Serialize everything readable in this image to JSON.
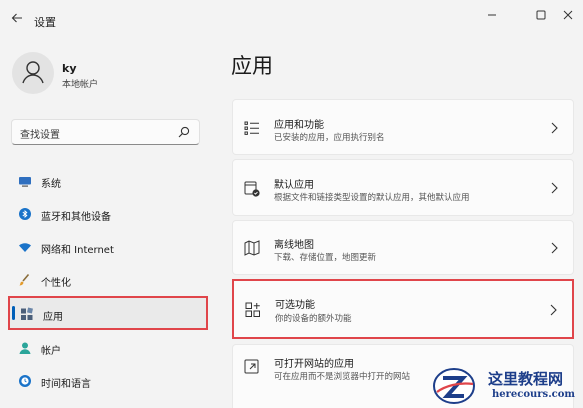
{
  "window": {
    "title": "设置",
    "back_icon": "back-arrow-icon",
    "controls": [
      "minimize-icon",
      "maximize-icon",
      "close-icon"
    ]
  },
  "user": {
    "name": "ky",
    "account_type": "本地帐户"
  },
  "search": {
    "placeholder": "查找设置"
  },
  "sidebar": {
    "items": [
      {
        "label": "系统",
        "icon": "system-icon"
      },
      {
        "label": "蓝牙和其他设备",
        "icon": "bluetooth-icon"
      },
      {
        "label": "网络和 Internet",
        "icon": "wifi-icon"
      },
      {
        "label": "个性化",
        "icon": "brush-icon"
      },
      {
        "label": "应用",
        "icon": "apps-icon",
        "active": true
      },
      {
        "label": "帐户",
        "icon": "person-icon"
      },
      {
        "label": "时间和语言",
        "icon": "globe-clock-icon"
      }
    ]
  },
  "main": {
    "title": "应用",
    "cards": [
      {
        "title": "应用和功能",
        "subtitle": "已安装的应用，应用执行别名",
        "icon": "list-icon"
      },
      {
        "title": "默认应用",
        "subtitle": "根据文件和链接类型设置的默认应用，其他默认应用",
        "icon": "default-app-icon"
      },
      {
        "title": "离线地图",
        "subtitle": "下载、存储位置，地图更新",
        "icon": "map-icon"
      },
      {
        "title": "可选功能",
        "subtitle": "你的设备的额外功能",
        "icon": "optional-features-icon",
        "highlighted": true
      },
      {
        "title": "可打开网站的应用",
        "subtitle": "可在应用而不是浏览器中打开的网站",
        "icon": "open-web-icon"
      }
    ]
  },
  "watermark": {
    "title": "这里教程网",
    "url": "herecours.com"
  },
  "colors": {
    "highlight_border": "#e0454a",
    "accent": "#005fb8",
    "watermark": "#1d3e8a"
  }
}
